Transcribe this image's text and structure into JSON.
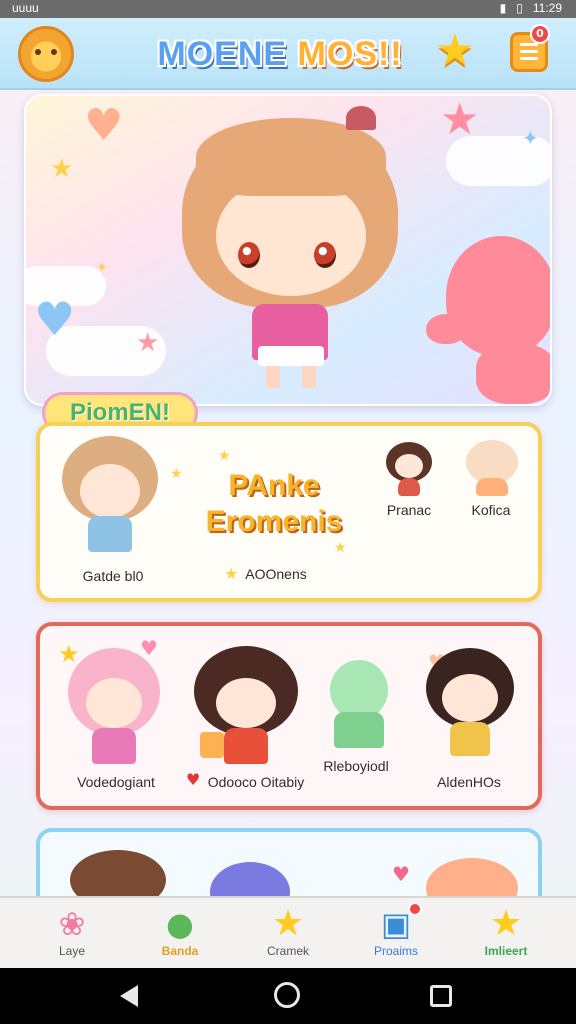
{
  "status_bar": {
    "left": "uuuu",
    "right": "11:29"
  },
  "header": {
    "title_main": "MOENE",
    "title_accent": "MOS!!",
    "notification_count": "0"
  },
  "promo_label": "PiomEN!",
  "card_1": {
    "big_promo_line1": "PAnke",
    "big_promo_line2": "Eromenis",
    "items": [
      {
        "label": "Gatde bl0"
      },
      {
        "label": "AOOnens"
      },
      {
        "label": "Pranac"
      },
      {
        "label": "Kofica"
      }
    ]
  },
  "card_2": {
    "items": [
      {
        "label": "Vodedogiant"
      },
      {
        "label": "Odooco Oitabiy"
      },
      {
        "label": "Rleboyiodl"
      },
      {
        "label": "AldenHOs"
      }
    ]
  },
  "bottom_nav": {
    "items": [
      {
        "label": "Laye",
        "icon": "creature-icon"
      },
      {
        "label": "Banda",
        "icon": "badge-icon"
      },
      {
        "label": "Cramek",
        "icon": "star-icon"
      },
      {
        "label": "Proaims",
        "icon": "gift-icon"
      },
      {
        "label": "Imlieert",
        "icon": "star-icon"
      }
    ]
  },
  "colors": {
    "header_bg": "#cfeefc",
    "card_1_border": "#f8cf59",
    "card_2_border": "#e26a5a",
    "card_3_border": "#8ed1f0",
    "accent_orange": "#ffb035",
    "accent_blue": "#5aa0f0"
  }
}
